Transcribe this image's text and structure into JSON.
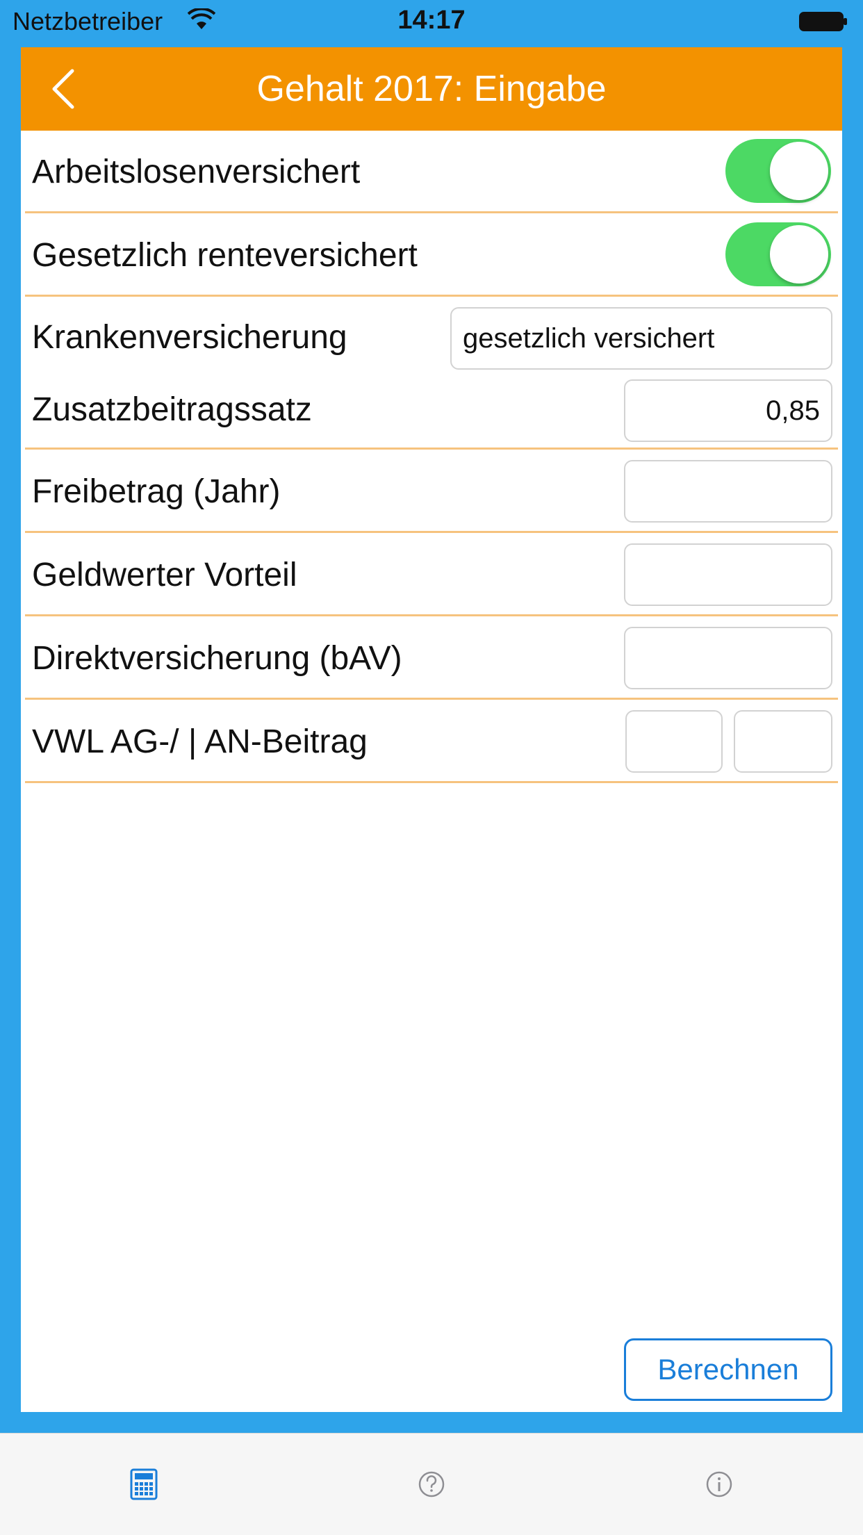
{
  "status_bar": {
    "carrier": "Netzbetreiber",
    "time": "14:17",
    "icons": [
      "wifi-icon",
      "battery-icon"
    ]
  },
  "nav": {
    "title": "Gehalt 2017: Eingabe",
    "back_icon": "chevron-left-icon"
  },
  "form": {
    "arbeitslos": {
      "label": "Arbeitslosenversichert",
      "on": true
    },
    "rente": {
      "label": "Gesetzlich renteversichert",
      "on": true
    },
    "kranken": {
      "label": "Krankenversicherung",
      "value": "gesetzlich versichert"
    },
    "zusatz": {
      "label": "Zusatzbeitragssatz",
      "value": "0,85"
    },
    "freibetrag": {
      "label": "Freibetrag (Jahr)",
      "value": ""
    },
    "geldwert": {
      "label": "Geldwerter Vorteil",
      "value": ""
    },
    "direkt": {
      "label": "Direktversicherung (bAV)",
      "value": ""
    },
    "vwl": {
      "label": "VWL AG-/ | AN-Beitrag",
      "ag_value": "",
      "an_value": ""
    }
  },
  "actions": {
    "calculate_label": "Berechnen"
  },
  "tabbar": {
    "tabs": [
      {
        "icon": "calculator-icon",
        "active": true
      },
      {
        "icon": "question-circle-icon",
        "active": false
      },
      {
        "icon": "info-circle-icon",
        "active": false
      }
    ]
  },
  "colors": {
    "background": "#2ea4ea",
    "nav_bar": "#f39200",
    "separator": "#f6c37e",
    "switch_on": "#4cd964",
    "accent_blue": "#1a7ed9",
    "tab_inactive": "#8e8e93"
  }
}
